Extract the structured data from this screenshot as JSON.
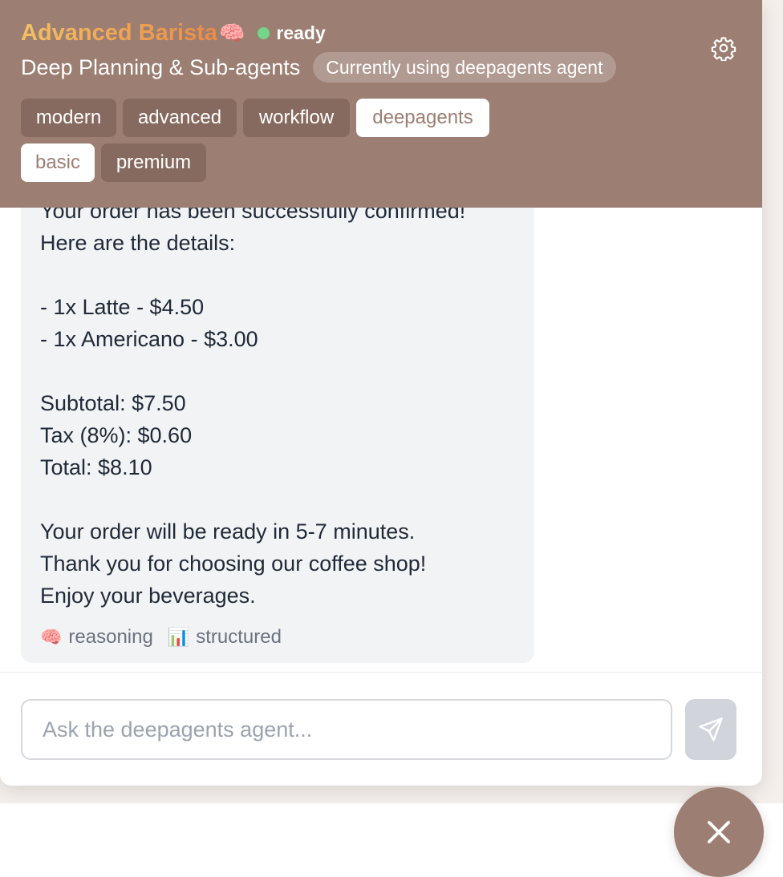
{
  "header": {
    "title": "Advanced Barista",
    "title_emoji": "🧠",
    "status": "ready",
    "subtitle": "Deep Planning & Sub-agents",
    "current_agent_pill": "Currently using deepagents agent",
    "settings_icon": "gear-icon"
  },
  "tags": [
    {
      "label": "modern",
      "active": false
    },
    {
      "label": "advanced",
      "active": false
    },
    {
      "label": "workflow",
      "active": false
    },
    {
      "label": "deepagents",
      "active": true
    },
    {
      "label": "basic",
      "active": true
    },
    {
      "label": "premium",
      "active": false
    }
  ],
  "message": {
    "lines": [
      "Your order has been successfully confirmed!",
      "Here are the details:",
      "",
      "- 1x Latte - $4.50",
      "- 1x Americano - $3.00",
      "",
      "Subtotal: $7.50",
      "Tax (8%): $0.60",
      "Total: $8.10",
      "",
      "Your order will be ready in 5-7 minutes.",
      "Thank you for choosing our coffee shop!",
      "Enjoy your beverages."
    ],
    "meta": [
      {
        "icon": "🧠",
        "label": "reasoning"
      },
      {
        "icon": "📊",
        "label": "structured"
      }
    ]
  },
  "composer": {
    "placeholder": "Ask the deepagents agent...",
    "send_icon": "send-icon"
  },
  "fab": {
    "icon": "close-icon"
  },
  "colors": {
    "header_bg": "#9c7e73",
    "tag_bg": "#866a5f",
    "status_green": "#73d68a",
    "bubble_bg": "#f2f3f5"
  }
}
